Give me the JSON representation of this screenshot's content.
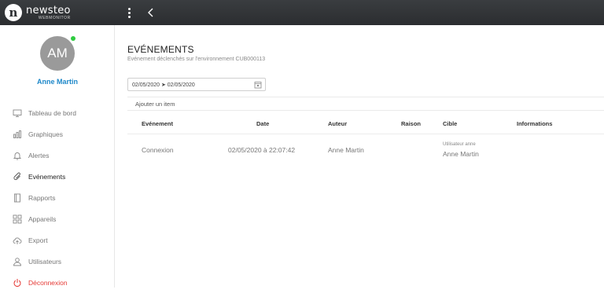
{
  "topbar": {
    "logo_mark": "n",
    "logo_name": "newsteo",
    "logo_sub": "WEBMONITOR"
  },
  "user": {
    "initials": "AM",
    "name": "Anne Martin",
    "status_color": "#2ecc40"
  },
  "sidebar": {
    "items": [
      {
        "label": "Tableau de bord",
        "icon": "monitor-icon"
      },
      {
        "label": "Graphiques",
        "icon": "bar-chart-icon"
      },
      {
        "label": "Alertes",
        "icon": "bell-icon"
      },
      {
        "label": "Evénements",
        "icon": "paperclip-icon",
        "active": true
      },
      {
        "label": "Rapports",
        "icon": "document-icon"
      },
      {
        "label": "Appareils",
        "icon": "grid-icon"
      },
      {
        "label": "Export",
        "icon": "cloud-upload-icon"
      },
      {
        "label": "Utilisateurs",
        "icon": "user-icon"
      },
      {
        "label": "Déconnexion",
        "icon": "power-icon",
        "color": "#e53935"
      }
    ]
  },
  "main": {
    "title": "EVÉNEMENTS",
    "subtitle": "Evénement déclenchés sur l'environnement CUB000113",
    "date_range": "02/05/2020 ➤ 02/05/2020",
    "add_item_label": "Ajouter un item",
    "table": {
      "columns": [
        "Evénement",
        "Date",
        "Auteur",
        "Raison",
        "Cible",
        "Informations"
      ],
      "rows": [
        {
          "event": "Connexion",
          "date": "02/05/2020 à 22:07:42",
          "author": "Anne Martin",
          "reason": "",
          "target_label": "Utilisateur anne",
          "target_value": "Anne Martin",
          "info": ""
        }
      ]
    }
  },
  "colors": {
    "topbar": "#2b2d30",
    "accent": "#1e88c9",
    "logout": "#e53935"
  }
}
